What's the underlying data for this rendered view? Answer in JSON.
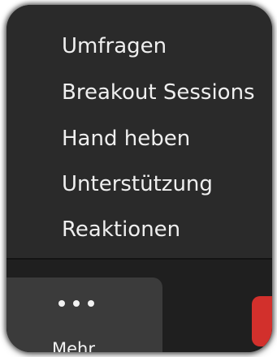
{
  "menu": {
    "items": [
      {
        "label": "Umfragen"
      },
      {
        "label": "Breakout Sessions"
      },
      {
        "label": "Hand heben"
      },
      {
        "label": "Unterstützung"
      },
      {
        "label": "Reaktionen"
      }
    ]
  },
  "toolbar": {
    "more_label": "Mehr",
    "more_icon": "ellipsis-icon"
  },
  "colors": {
    "menu_bg": "#2a2a2a",
    "toolbar_bg": "#1f1f1f",
    "more_button_bg": "#3b3b3b",
    "text": "#efefef",
    "accent_red": "#d2302c"
  }
}
